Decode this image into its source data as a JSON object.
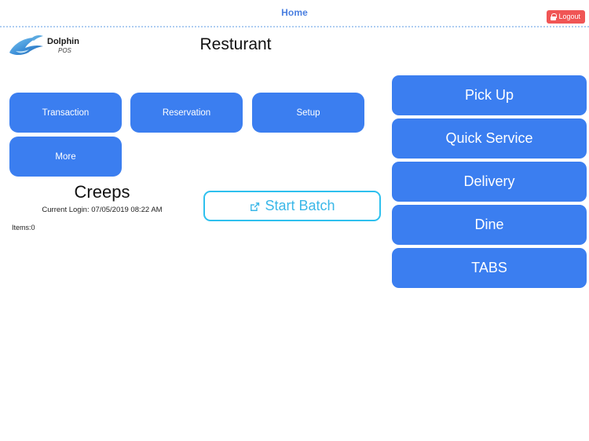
{
  "navbar": {
    "home_label": "Home",
    "logout_label": "Logout",
    "logout_icon": "lock-icon",
    "accent_color": "#4a7fe0",
    "logout_color": "#f05555"
  },
  "header": {
    "logo_text": "Dolphin",
    "logo_subtext": "POS",
    "logo_icon": "dolphin-logo",
    "title": "Resturant"
  },
  "action_buttons": [
    {
      "id": "transaction",
      "label": "Transaction"
    },
    {
      "id": "reservation",
      "label": "Reservation"
    },
    {
      "id": "setup",
      "label": "Setup"
    },
    {
      "id": "more",
      "label": "More"
    }
  ],
  "order_types": [
    {
      "id": "pickup",
      "label": "Pick Up"
    },
    {
      "id": "quickservice",
      "label": "Quick Service"
    },
    {
      "id": "delivery",
      "label": "Delivery"
    },
    {
      "id": "dine",
      "label": "Dine"
    },
    {
      "id": "tabs",
      "label": "TABS"
    }
  ],
  "store": {
    "name": "Creeps",
    "login_info": "Current Login: 07/05/2019 08:22 AM",
    "items_count": "Items:0"
  },
  "batch": {
    "label": "Start Batch",
    "icon": "external-link-icon",
    "border_color": "#2ec0ee",
    "text_color": "#3ab7e8"
  },
  "theme": {
    "primary_blue": "#3b7ef0",
    "nav_dotted_border": "#aecdf2"
  }
}
